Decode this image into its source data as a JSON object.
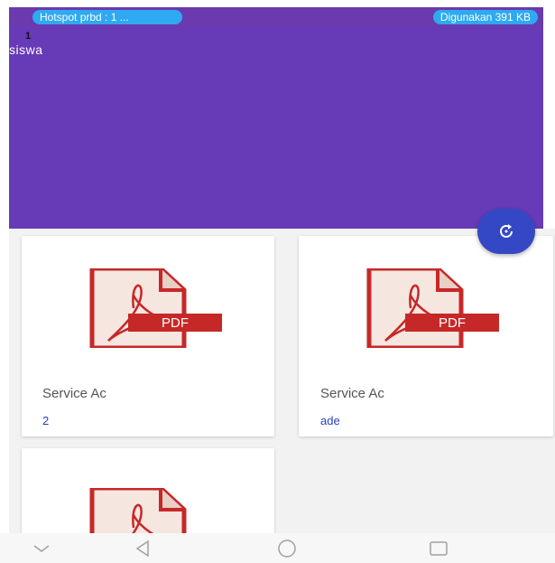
{
  "status_bar": {
    "hotspot_label": "Hotspot prbd : 1 ...",
    "usage_label": "Digunakan 391 KB"
  },
  "header": {
    "count": "1",
    "title": "siswa"
  },
  "cards": [
    {
      "title": "Service Ac",
      "subtitle": "2",
      "icon": "pdf-file-icon"
    },
    {
      "title": "Service Ac",
      "subtitle": "ade",
      "icon": "pdf-file-icon"
    },
    {
      "title": "",
      "subtitle": "",
      "icon": "pdf-file-icon"
    }
  ],
  "pdf_icon_text": "PDF",
  "fab": {
    "icon": "refresh-icon"
  },
  "navbar": {
    "icons": [
      "chevron-down-icon",
      "back-icon",
      "home-icon",
      "recent-apps-icon"
    ]
  },
  "colors": {
    "header": "#673ab7",
    "status_pill": "#2ea9f2",
    "fab": "#3448c5",
    "subtitle": "#2a3fbf",
    "pdf_red": "#c62828"
  }
}
